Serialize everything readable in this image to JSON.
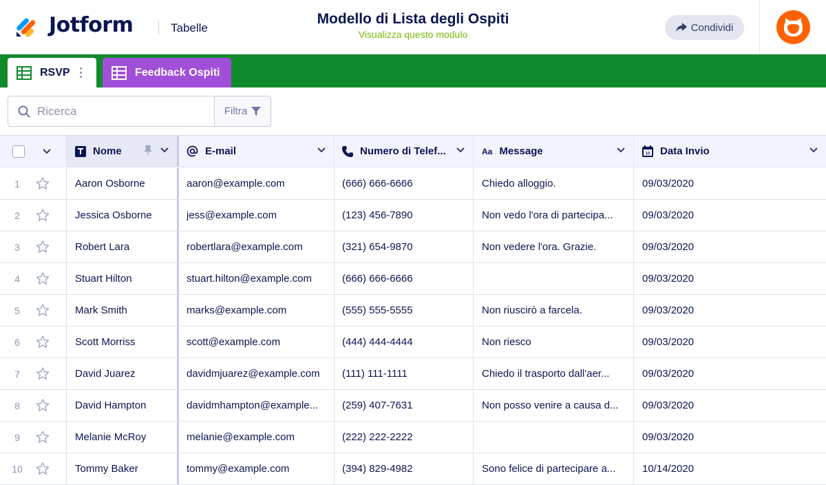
{
  "header": {
    "brand": "Jotform",
    "section": "Tabelle",
    "title": "Modello di Lista degli Ospiti",
    "subtitle": "Visualizza questo modulo",
    "share_label": "Condividi"
  },
  "colors": {
    "accent_green": "#0f8b2c",
    "feedback_tab": "#a14fd8",
    "avatar": "#ff6100",
    "subtitle_green": "#78bb07"
  },
  "tabs": [
    {
      "label": "RSVP",
      "icon": "grid-icon"
    },
    {
      "label": "Feedback Ospiti",
      "icon": "grid-icon"
    }
  ],
  "search": {
    "placeholder": "Ricerca",
    "filter_label": "Filtra"
  },
  "columns": [
    {
      "label": "Nome",
      "icon": "text-type-icon"
    },
    {
      "label": "E-mail",
      "icon": "at-icon"
    },
    {
      "label": "Numero di Telef...",
      "icon": "phone-icon"
    },
    {
      "label": "Message",
      "icon": "text-size-icon"
    },
    {
      "label": "Data Invio",
      "icon": "calendar-icon"
    }
  ],
  "rows": [
    {
      "num": "1",
      "name": "Aaron Osborne",
      "email": "aaron@example.com",
      "phone": "(666) 666-6666",
      "message": "Chiedo alloggio.",
      "date": "09/03/2020"
    },
    {
      "num": "2",
      "name": "Jessica Osborne",
      "email": "jess@example.com",
      "phone": "(123) 456-7890",
      "message": "Non vedo l'ora di partecipa...",
      "date": "09/03/2020"
    },
    {
      "num": "3",
      "name": "Robert Lara",
      "email": "robertlara@example.com",
      "phone": "(321) 654-9870",
      "message": "Non vedere l'ora. Grazie.",
      "date": "09/03/2020"
    },
    {
      "num": "4",
      "name": "Stuart Hilton",
      "email": "stuart.hilton@example.com",
      "phone": "(666) 666-6666",
      "message": "",
      "date": "09/03/2020"
    },
    {
      "num": "5",
      "name": "Mark Smith",
      "email": "marks@example.com",
      "phone": "(555) 555-5555",
      "message": "Non riuscirò a farcela.",
      "date": "09/03/2020"
    },
    {
      "num": "6",
      "name": "Scott Morriss",
      "email": "scott@example.com",
      "phone": "(444) 444-4444",
      "message": "Non riesco",
      "date": "09/03/2020"
    },
    {
      "num": "7",
      "name": "David Juarez",
      "email": "davidmjuarez@example.com",
      "phone": "(111) 111-1111",
      "message": "Chiedo il trasporto dall'aer...",
      "date": "09/03/2020"
    },
    {
      "num": "8",
      "name": "David Hampton",
      "email": "davidmhampton@example...",
      "phone": "(259) 407-7631",
      "message": "Non posso venire a causa d...",
      "date": "09/03/2020"
    },
    {
      "num": "9",
      "name": "Melanie McRoy",
      "email": "melanie@example.com",
      "phone": "(222) 222-2222",
      "message": "",
      "date": "09/03/2020"
    },
    {
      "num": "10",
      "name": "Tommy Baker",
      "email": "tommy@example.com",
      "phone": "(394) 829-4982",
      "message": "Sono felice di partecipare a...",
      "date": "10/14/2020"
    }
  ]
}
